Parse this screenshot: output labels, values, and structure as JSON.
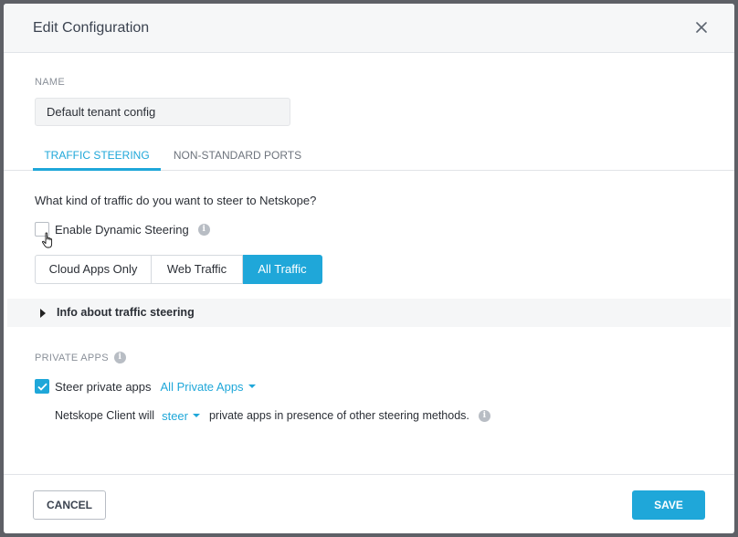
{
  "dialog": {
    "title": "Edit Configuration",
    "close_icon": "close-icon"
  },
  "name_field": {
    "label": "NAME",
    "value": "Default tenant config"
  },
  "tabs": [
    {
      "label": "TRAFFIC STEERING",
      "active": true
    },
    {
      "label": "NON-STANDARD PORTS",
      "active": false
    }
  ],
  "traffic": {
    "question": "What kind of traffic do you want to steer to Netskope?",
    "dynamic_steering_label": "Enable Dynamic Steering",
    "dynamic_steering_checked": false,
    "options": [
      "Cloud Apps Only",
      "Web Traffic",
      "All Traffic"
    ],
    "selected_option": "All Traffic",
    "info_toggle": "Info about traffic steering"
  },
  "private_apps": {
    "section_label": "PRIVATE APPS",
    "steer_label": "Steer private apps",
    "steer_checked": true,
    "scope_value": "All Private Apps",
    "client_prefix": "Netskope Client will",
    "client_action": "steer",
    "client_suffix": "private apps in presence of other steering methods."
  },
  "footer": {
    "cancel_label": "CANCEL",
    "save_label": "SAVE"
  },
  "colors": {
    "accent": "#1fa7d9"
  }
}
